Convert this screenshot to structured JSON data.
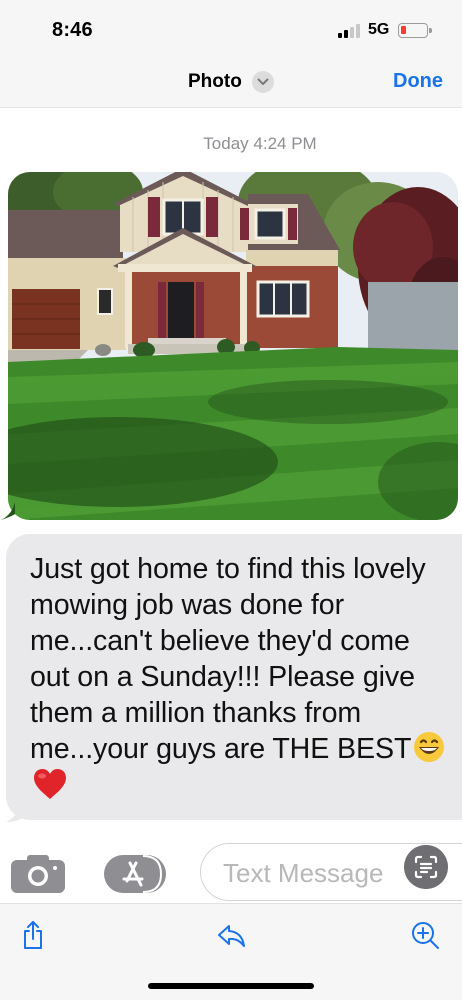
{
  "status_bar": {
    "time": "8:46",
    "network": "5G",
    "signal_bars_active": 2,
    "signal_bars_total": 4,
    "battery_level": 0.15,
    "battery_color": "#ff3b30"
  },
  "nav_bar": {
    "title": "Photo",
    "title_chevron_icon": "chevron-down-icon",
    "done_label": "Done",
    "accent_color": "#1a73e8"
  },
  "thread": {
    "timestamp_day": "Today",
    "timestamp_time": "4:24 PM",
    "photo_message": {
      "type": "image",
      "subject": "house-with-freshly-mowed-lawn"
    },
    "text_message": {
      "lines": [
        "Just got home to find this lovely",
        "mowing job was done for",
        "me...can't believe they'd come",
        "out on a Sunday!!! Please give",
        "them a million thanks from",
        "me...your guys are THE BEST"
      ],
      "emojis": [
        "grinning-face-emoji",
        "red-heart-emoji"
      ],
      "bubble_color": "#e9e9eb"
    }
  },
  "input_bar": {
    "camera_icon": "camera-icon",
    "apps_icon": "app-store-icon",
    "placeholder": "Text Message",
    "scan_icon": "live-text-scan-icon"
  },
  "toolbar": {
    "share_icon": "share-icon",
    "reply_icon": "reply-icon",
    "zoom_icon": "zoom-in-icon",
    "tint_color": "#1a73e8"
  }
}
